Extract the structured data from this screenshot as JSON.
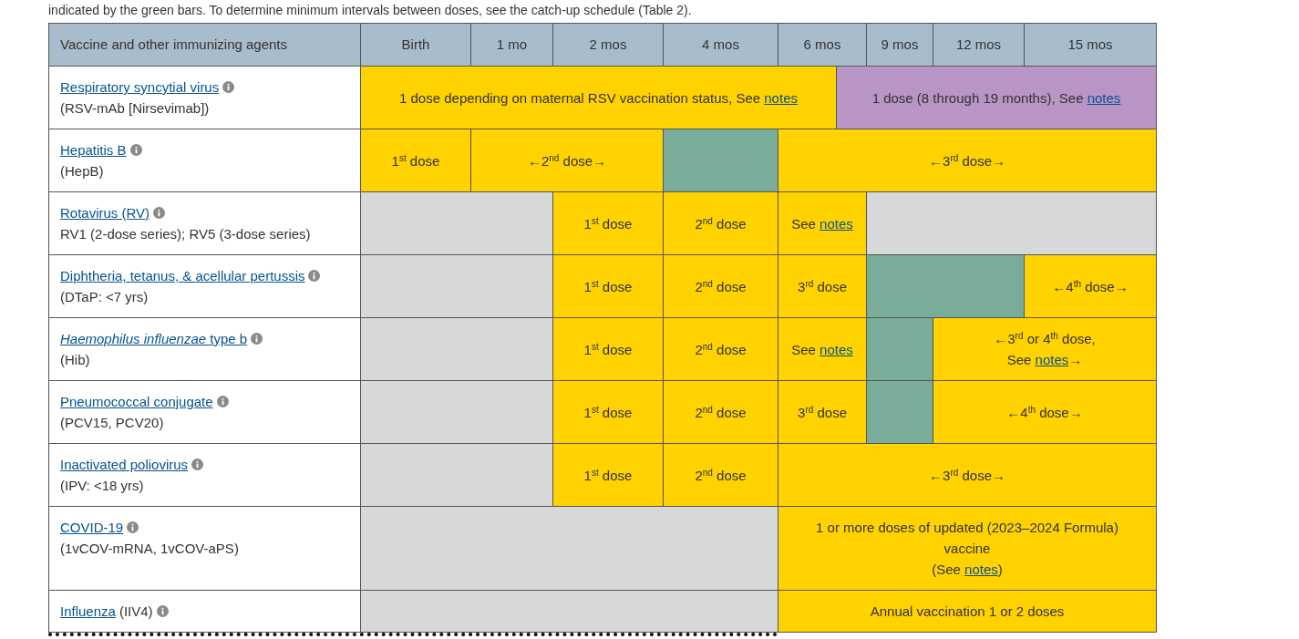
{
  "intro": "indicated by the green bars. To determine minimum intervals between doses, see the catch-up schedule (Table 2).",
  "table": {
    "vaccine_header": "Vaccine and other immunizing agents",
    "age_columns": [
      "Birth",
      "1 mo",
      "2 mos",
      "4 mos",
      "6 mos",
      "9 mos",
      "12 mos",
      "15 mos"
    ],
    "rows": [
      {
        "name": "Respiratory syncytial virus",
        "detail": "(RSV-mAb [Nirsevimab])",
        "schedule": [
          {
            "kind": "recommended",
            "parts": [
              {
                "kind": "text",
                "text": "1 dose depending on maternal RSV vaccination status, See"
              },
              {
                "kind": "link",
                "text": "notes"
              }
            ]
          },
          {
            "kind": "special",
            "parts": [
              {
                "kind": "text",
                "text": "1 dose (8 through 19 months), See"
              },
              {
                "kind": "link",
                "text": "notes"
              }
            ]
          }
        ]
      },
      {
        "name": "Hepatitis B",
        "detail": "(HepB)",
        "schedule": [
          {
            "kind": "recommended",
            "parts": [
              {
                "kind": "text",
                "text": "1$^{st}$ dose"
              }
            ]
          },
          {
            "kind": "recommended",
            "parts": [
              {
                "kind": "text",
                "text": "←2$^{nd}$ dose→"
              }
            ]
          },
          {
            "kind": "catchup"
          },
          {
            "kind": "recommended",
            "parts": [
              {
                "kind": "text",
                "text": "←3$^{rd}$ dose→"
              }
            ]
          }
        ]
      },
      {
        "name": "Rotavirus (RV)",
        "detail": "RV1 (2-dose series); RV5 (3-dose series)",
        "schedule": [
          {
            "kind": "none"
          },
          {
            "kind": "recommended",
            "parts": [
              {
                "kind": "text",
                "text": "1$^{st}$ dose"
              }
            ]
          },
          {
            "kind": "recommended",
            "parts": [
              {
                "kind": "text",
                "text": "2$^{nd}$ dose"
              }
            ]
          },
          {
            "kind": "recommended",
            "parts": [
              {
                "kind": "text",
                "text": "See"
              },
              {
                "kind": "link",
                "text": "notes"
              }
            ]
          },
          {
            "kind": "none"
          }
        ]
      },
      {
        "name": "Diphtheria, tetanus, & acellular pertussis",
        "detail": "(DTaP: <7 yrs)",
        "schedule": [
          {
            "kind": "none"
          },
          {
            "kind": "recommended",
            "parts": [
              {
                "kind": "text",
                "text": "1$^{st}$ dose"
              }
            ]
          },
          {
            "kind": "recommended",
            "parts": [
              {
                "kind": "text",
                "text": "2$^{nd}$ dose"
              }
            ]
          },
          {
            "kind": "recommended",
            "parts": [
              {
                "kind": "text",
                "text": "3$^{rd}$ dose"
              }
            ]
          },
          {
            "kind": "catchup"
          },
          {
            "kind": "recommended",
            "parts": [
              {
                "kind": "text",
                "text": "←4$^{th}$ dose→"
              }
            ]
          }
        ]
      },
      {
        "name": "*Haemophilus influenzae* type b",
        "detail": "(Hib)",
        "schedule": [
          {
            "kind": "none"
          },
          {
            "kind": "recommended",
            "parts": [
              {
                "kind": "text",
                "text": "1$^{st}$ dose"
              }
            ]
          },
          {
            "kind": "recommended",
            "parts": [
              {
                "kind": "text",
                "text": "2$^{nd}$ dose"
              }
            ]
          },
          {
            "kind": "recommended",
            "parts": [
              {
                "kind": "text",
                "text": "See"
              },
              {
                "kind": "link",
                "text": "notes"
              }
            ]
          },
          {
            "kind": "catchup"
          },
          {
            "kind": "recommended",
            "parts": [
              {
                "kind": "text",
                "text": "←3$^{rd}$ or 4$^{th}$ dose,"
              },
              {
                "kind": "break"
              },
              {
                "kind": "text",
                "text": "See"
              },
              {
                "kind": "link",
                "text": "notes"
              },
              {
                "kind": "text",
                "text": "→"
              }
            ]
          }
        ]
      },
      {
        "name": "Pneumococcal conjugate",
        "detail": "(PCV15, PCV20)",
        "schedule": [
          {
            "kind": "none"
          },
          {
            "kind": "recommended",
            "parts": [
              {
                "kind": "text",
                "text": "1$^{st}$ dose"
              }
            ]
          },
          {
            "kind": "recommended",
            "parts": [
              {
                "kind": "text",
                "text": "2$^{nd}$ dose"
              }
            ]
          },
          {
            "kind": "recommended",
            "parts": [
              {
                "kind": "text",
                "text": "3$^{rd}$ dose"
              }
            ]
          },
          {
            "kind": "catchup"
          },
          {
            "kind": "recommended",
            "parts": [
              {
                "kind": "text",
                "text": "←4$^{th}$ dose→"
              }
            ]
          }
        ]
      },
      {
        "name": "Inactivated poliovirus",
        "detail": "(IPV: <18 yrs)",
        "schedule": [
          {
            "kind": "none"
          },
          {
            "kind": "recommended",
            "parts": [
              {
                "kind": "text",
                "text": "1$^{st}$ dose"
              }
            ]
          },
          {
            "kind": "recommended",
            "parts": [
              {
                "kind": "text",
                "text": "2$^{nd}$ dose"
              }
            ]
          },
          {
            "kind": "recommended",
            "parts": [
              {
                "kind": "text",
                "text": "←3$^{rd}$ dose→"
              }
            ]
          }
        ]
      },
      {
        "name": "COVID-19",
        "detail": "(1vCOV-mRNA, 1vCOV-aPS)",
        "schedule": [
          {
            "kind": "none"
          },
          {
            "kind": "recommended",
            "parts": [
              {
                "kind": "text",
                "text": "1 or more doses of updated (2023–2024 Formula) vaccine"
              },
              {
                "kind": "break"
              },
              {
                "kind": "text",
                "text": "(See"
              },
              {
                "kind": "link",
                "text": "notes"
              },
              {
                "kind": "text",
                "text": ")"
              }
            ]
          }
        ]
      },
      {
        "name": "Influenza",
        "inline_detail": "(IIV4)",
        "schedule": [
          {
            "kind": "none"
          },
          {
            "kind": "recommended",
            "parts": [
              {
                "kind": "text",
                "text": "Annual vaccination 1 or 2 doses"
              }
            ]
          }
        ]
      }
    ]
  }
}
